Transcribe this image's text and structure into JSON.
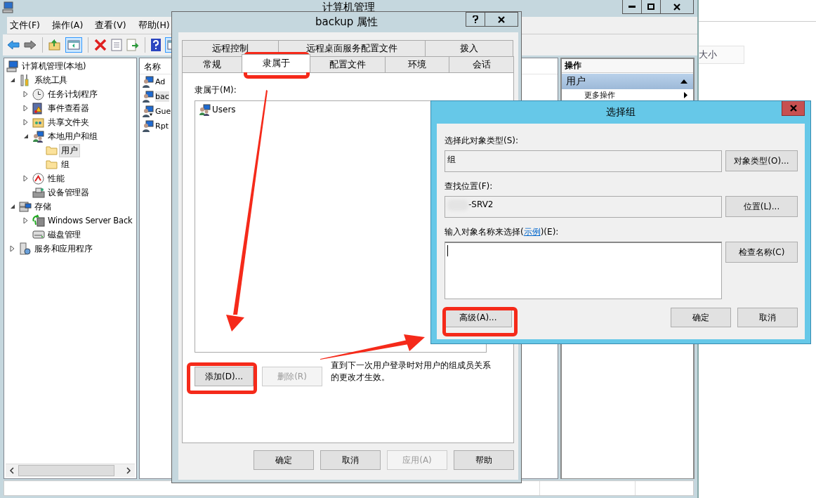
{
  "main_window": {
    "title": "计算机管理",
    "menu": [
      "文件(F)",
      "操作(A)",
      "查看(V)",
      "帮助(H)"
    ],
    "tree": [
      {
        "label": "计算机管理(本地)",
        "kind": "computer",
        "selected": false,
        "children": [
          {
            "label": "系统工具",
            "kind": "tools",
            "selected": false,
            "expanded": true,
            "children": [
              {
                "label": "任务计划程序",
                "kind": "clock",
                "selected": false,
                "expanded": false
              },
              {
                "label": "事件查看器",
                "kind": "event",
                "selected": false,
                "expanded": false
              },
              {
                "label": "共享文件夹",
                "kind": "share",
                "selected": false,
                "expanded": false
              },
              {
                "label": "本地用户和组",
                "kind": "users",
                "selected": false,
                "expanded": true,
                "children": [
                  {
                    "label": "用户",
                    "kind": "folder",
                    "selected": true
                  },
                  {
                    "label": "组",
                    "kind": "folder",
                    "selected": false
                  }
                ]
              },
              {
                "label": "性能",
                "kind": "perf",
                "selected": false,
                "expanded": false
              },
              {
                "label": "设备管理器",
                "kind": "device",
                "selected": false
              }
            ]
          },
          {
            "label": "存储",
            "kind": "storage",
            "selected": false,
            "expanded": true,
            "children": [
              {
                "label": "Windows Server Back",
                "kind": "backup",
                "selected": false,
                "expanded": false
              },
              {
                "label": "磁盘管理",
                "kind": "disk",
                "selected": false
              }
            ]
          },
          {
            "label": "服务和应用程序",
            "kind": "services",
            "selected": false,
            "expanded": false
          }
        ]
      }
    ],
    "list": {
      "columns": [
        "名称"
      ],
      "rows": [
        {
          "name": "Ad",
          "selected": false,
          "disabled": false
        },
        {
          "name": "bac",
          "selected": true,
          "disabled": false
        },
        {
          "name": "Gue",
          "selected": false,
          "disabled": true
        },
        {
          "name": "Rpt",
          "selected": false,
          "disabled": false
        }
      ]
    },
    "actions": {
      "title": "操作",
      "section": "用户",
      "items": [
        "更多操作"
      ]
    }
  },
  "background_window": {
    "field_text": "大小"
  },
  "backup_dialog": {
    "title": "backup 属性",
    "tabs_row_1": [
      {
        "label": "远程控制",
        "selected": false
      },
      {
        "label": "远程桌面服务配置文件",
        "selected": false
      },
      {
        "label": "拨入",
        "selected": false
      }
    ],
    "tabs_row_2": [
      {
        "label": "常规",
        "selected": false
      },
      {
        "label": "隶属于",
        "selected": true
      },
      {
        "label": "配置文件",
        "selected": false
      },
      {
        "label": "环境",
        "selected": false
      },
      {
        "label": "会话",
        "selected": false
      }
    ],
    "member_of_label": "隶属于(M):",
    "members": [
      "Users"
    ],
    "buttons": [
      {
        "label": "添加(D)...",
        "disabled": false
      },
      {
        "label": "删除(R)",
        "disabled": true
      }
    ],
    "note": "直到下一次用户登录时对用户的组成员关系的更改才生效。",
    "footer_buttons": [
      {
        "label": "确定",
        "disabled": false
      },
      {
        "label": "取消",
        "disabled": false
      },
      {
        "label": "应用(A)",
        "disabled": true
      },
      {
        "label": "帮助",
        "disabled": false
      }
    ]
  },
  "select_group_dialog": {
    "title": "选择组",
    "object_type_label": "选择此对象类型(S):",
    "object_type": "组",
    "object_type_button": "对象类型(O)...",
    "location_label": "查找位置(F):",
    "location": "-SRV2",
    "location_button": "位置(L)...",
    "names_label_before": "输入对象名称来选择(",
    "names_link": "示例",
    "names_label_after": ")(E):",
    "check_button": "检查名称(C)",
    "advanced_button": "高级(A)...",
    "ok_button": "确定",
    "cancel_button": "取消"
  }
}
